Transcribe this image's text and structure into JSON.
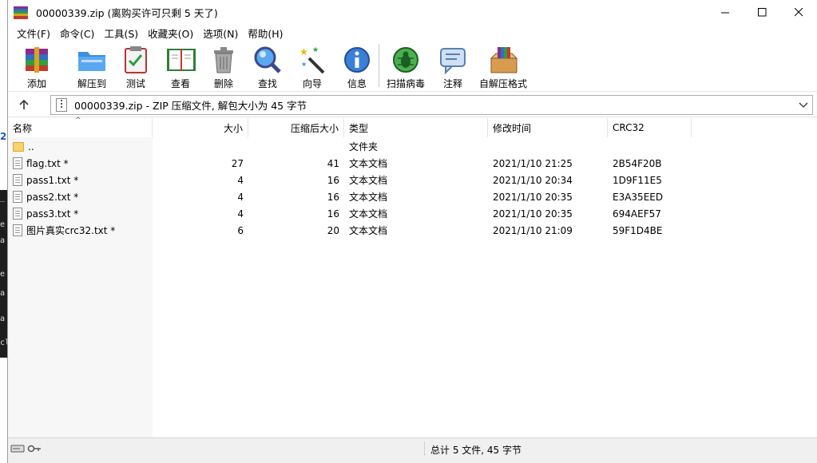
{
  "window": {
    "title": "00000339.zip (离购买许可只剩 5 天了)"
  },
  "menu": [
    "文件(F)",
    "命令(C)",
    "工具(S)",
    "收藏夹(O)",
    "选项(N)",
    "帮助(H)"
  ],
  "toolbar": {
    "buttons": [
      {
        "label": "添加",
        "icon": "add-archive-icon"
      },
      {
        "label": "解压到",
        "icon": "extract-to-icon"
      },
      {
        "label": "测试",
        "icon": "test-icon"
      },
      {
        "label": "查看",
        "icon": "view-icon"
      },
      {
        "label": "删除",
        "icon": "delete-icon"
      },
      {
        "label": "查找",
        "icon": "find-icon"
      },
      {
        "label": "向导",
        "icon": "wizard-icon"
      },
      {
        "label": "信息",
        "icon": "info-icon"
      },
      {
        "label": "扫描病毒",
        "icon": "virus-scan-icon"
      },
      {
        "label": "注释",
        "icon": "comment-icon"
      },
      {
        "label": "自解压格式",
        "icon": "sfx-icon"
      }
    ]
  },
  "address": {
    "text": "00000339.zip - ZIP 压缩文件, 解包大小为 45 字节"
  },
  "table": {
    "columns": [
      "名称",
      "大小",
      "压缩后大小",
      "类型",
      "修改时间",
      "CRC32"
    ],
    "parent_row": {
      "name": "..",
      "type": "文件夹"
    },
    "rows": [
      {
        "name": "flag.txt *",
        "size": "27",
        "packed": "41",
        "type": "文本文档",
        "modified": "2021/1/10 21:25",
        "crc": "2B54F20B"
      },
      {
        "name": "pass1.txt *",
        "size": "4",
        "packed": "16",
        "type": "文本文档",
        "modified": "2021/1/10 20:34",
        "crc": "1D9F11E5"
      },
      {
        "name": "pass2.txt *",
        "size": "4",
        "packed": "16",
        "type": "文本文档",
        "modified": "2021/1/10 20:35",
        "crc": "E3A35EED"
      },
      {
        "name": "pass3.txt *",
        "size": "4",
        "packed": "16",
        "type": "文本文档",
        "modified": "2021/1/10 20:35",
        "crc": "694AEF57"
      },
      {
        "name": "图片真实crc32.txt *",
        "size": "6",
        "packed": "20",
        "type": "文本文档",
        "modified": "2021/1/10 21:09",
        "crc": "59F1D4BE"
      }
    ]
  },
  "status": {
    "text": "总计 5 文件, 45 字节"
  },
  "background_fragments": {
    "blue_char": "2",
    "dark_chars": [
      "_",
      "e",
      "a",
      "e",
      "a",
      "a",
      "cl"
    ]
  }
}
